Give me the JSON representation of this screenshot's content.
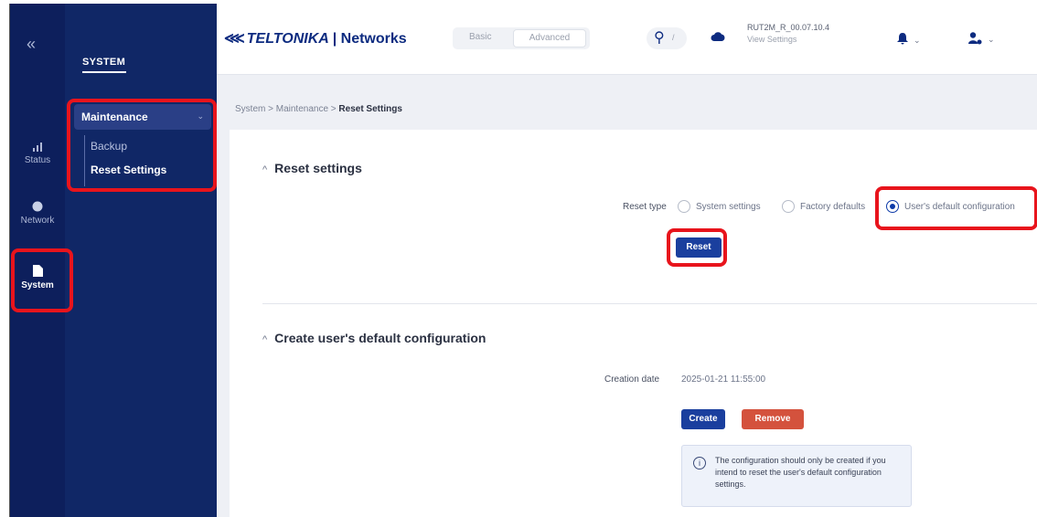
{
  "rail": {
    "collapse_icon": "double-chevron-left-icon",
    "items": [
      {
        "label": "Status",
        "icon": "signal-icon"
      },
      {
        "label": "Network",
        "icon": "globe-icon"
      },
      {
        "label": "System",
        "icon": "file-icon"
      }
    ]
  },
  "submenu": {
    "title": "SYSTEM",
    "group": "Maintenance",
    "items": [
      "Backup",
      "Reset Settings"
    ]
  },
  "topbar": {
    "logo_brand": "TELTONIKA",
    "logo_sep": "|",
    "logo_sub": "Networks",
    "mode_basic": "Basic",
    "mode_advanced": "Advanced",
    "search_key": "/",
    "firmware": "RUT2M_R_00.07.10.4",
    "view_settings": "View Settings"
  },
  "breadcrumb": {
    "items": [
      "System",
      "Maintenance"
    ],
    "sep": ">",
    "current": "Reset Settings"
  },
  "reset": {
    "title": "Reset settings",
    "type_label": "Reset type",
    "options": [
      "System settings",
      "Factory defaults",
      "User's default configuration"
    ],
    "selected_index": 2,
    "button": "Reset"
  },
  "create": {
    "title": "Create user's default configuration",
    "date_label": "Creation date",
    "date_value": "2025-01-21 11:55:00",
    "create_button": "Create",
    "remove_button": "Remove",
    "info_text": "The configuration should only be created if you intend to reset the user's default configuration settings."
  },
  "colors": {
    "rail_bg": "#0d1f5c",
    "submenu_bg": "#102766",
    "primary": "#1a3f9e",
    "danger": "#d4523d",
    "highlight": "#e8141c"
  }
}
